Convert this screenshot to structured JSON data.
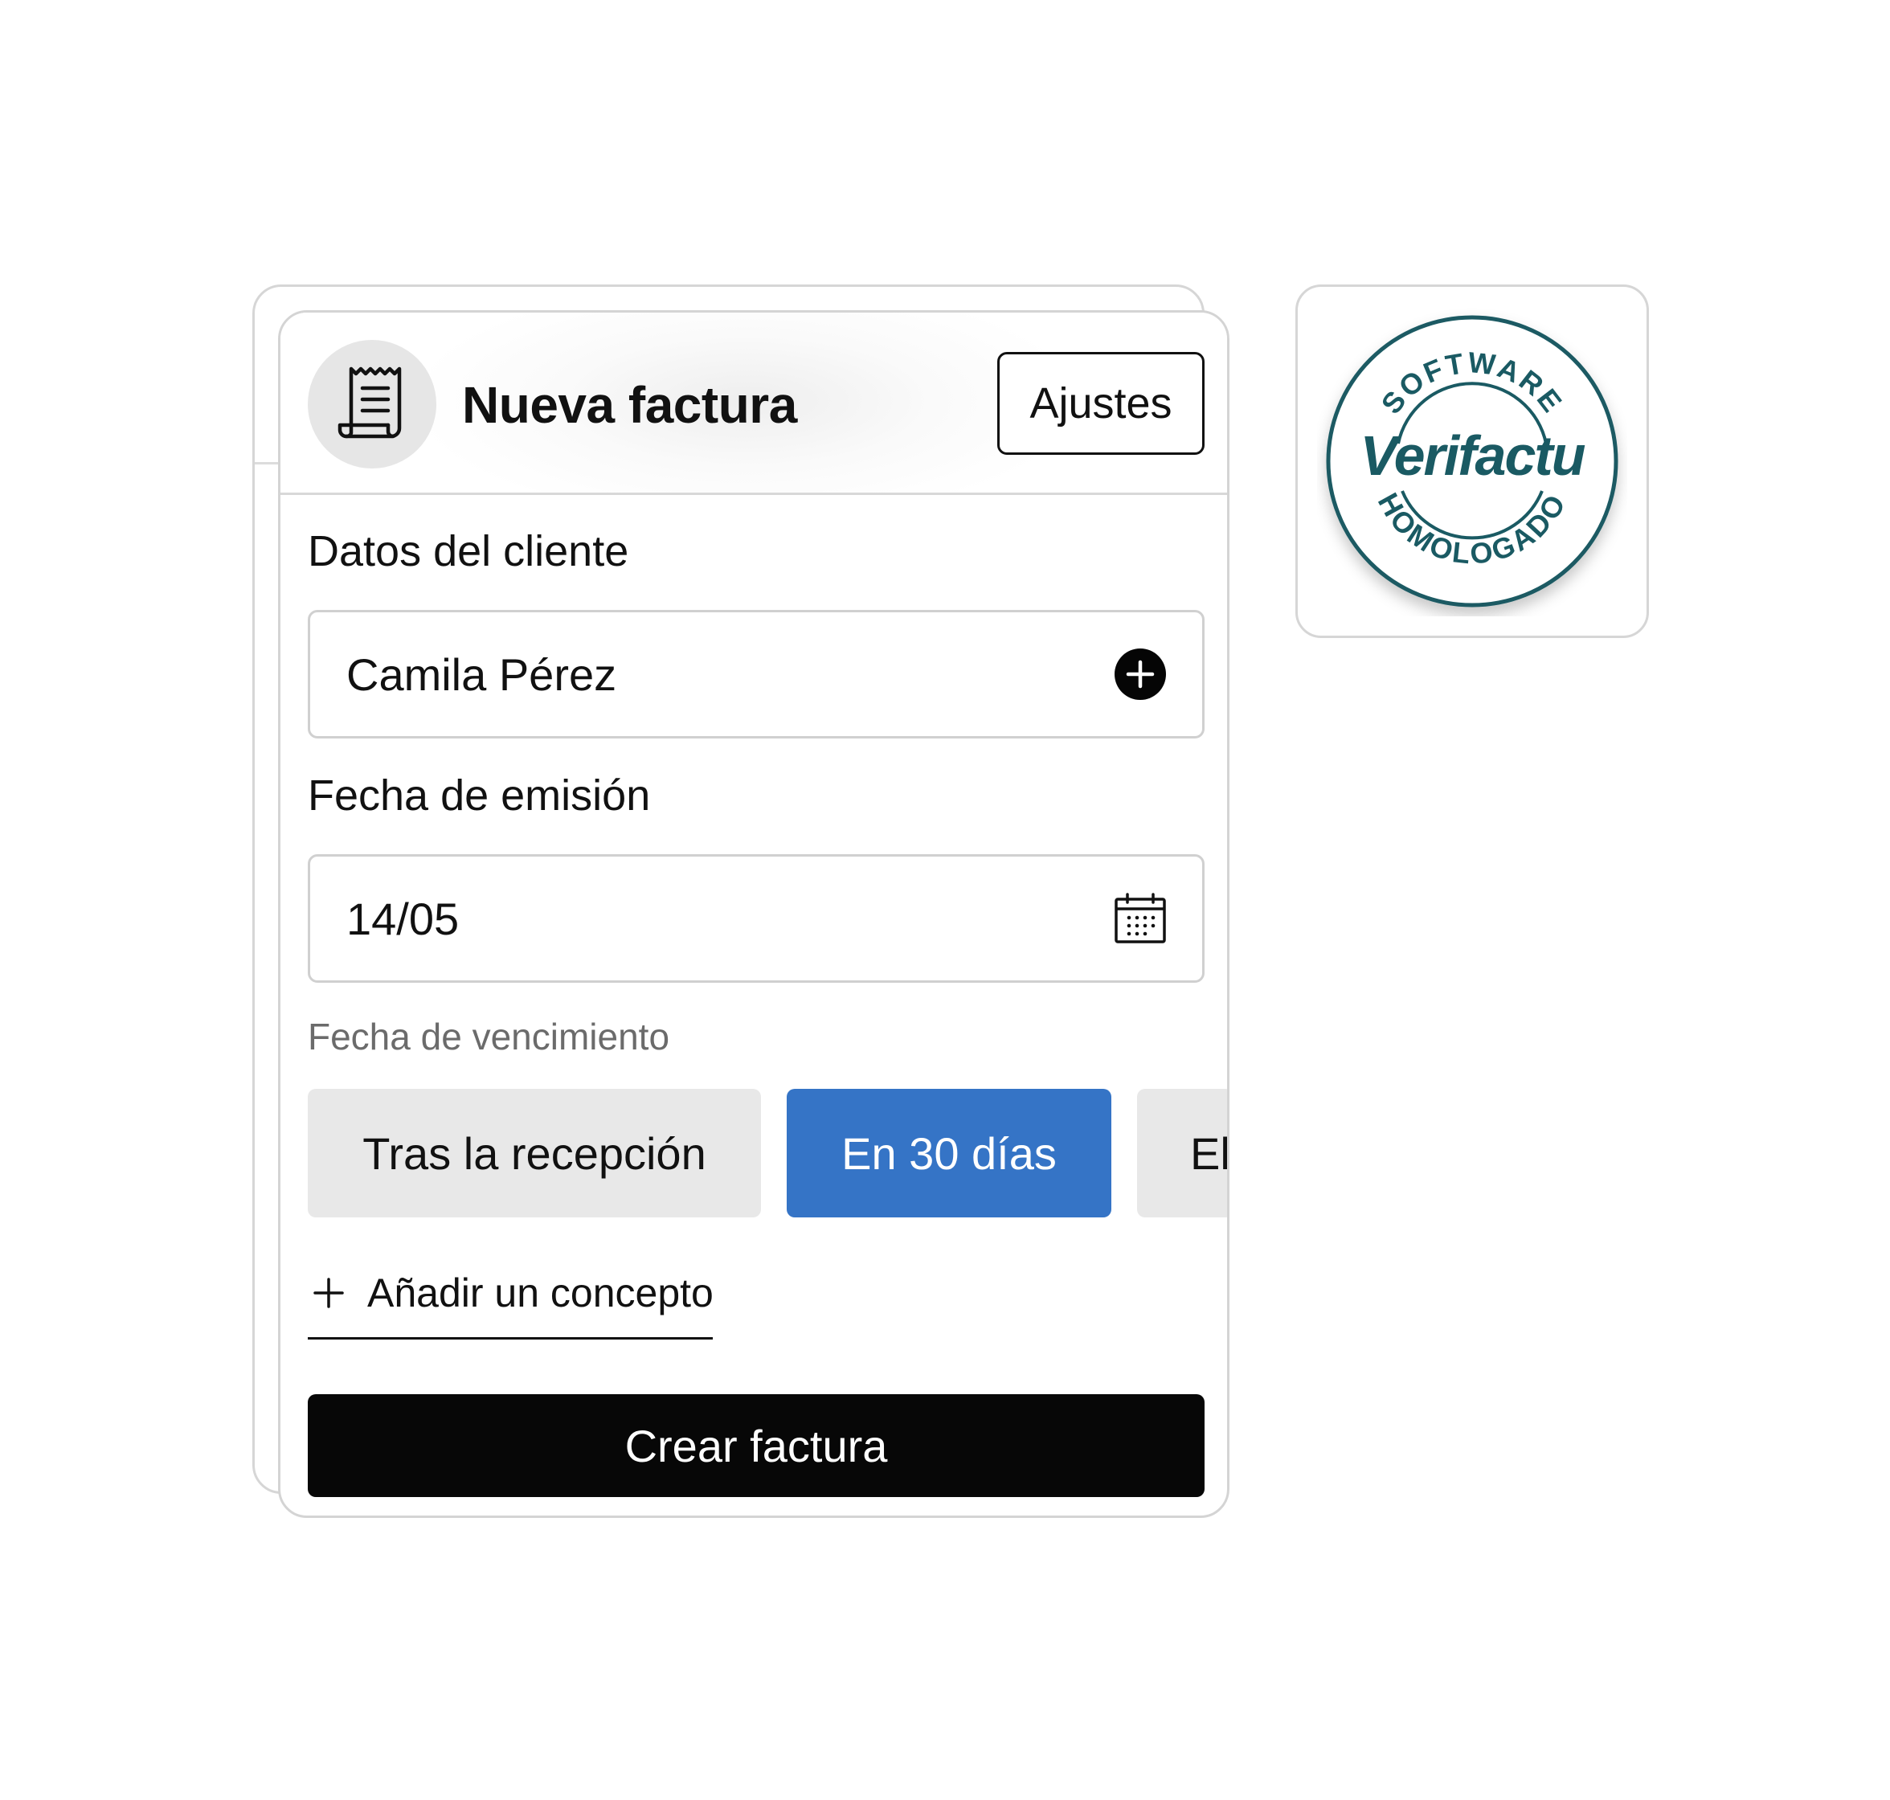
{
  "invoice_form": {
    "title": "Nueva factura",
    "settings_label": "Ajustes",
    "client": {
      "label": "Datos del cliente",
      "value": "Camila Pérez"
    },
    "issue_date": {
      "label": "Fecha de emisión",
      "value": "14/05"
    },
    "due_date": {
      "label": "Fecha de vencimiento",
      "options": [
        {
          "label": "Tras la recepción",
          "selected": false
        },
        {
          "label": "En 30 días",
          "selected": true
        },
        {
          "label": "El",
          "selected": false
        }
      ]
    },
    "add_concept_label": "Añadir un concepto",
    "create_label": "Crear factura"
  },
  "badge": {
    "top_text": "SOFTWARE",
    "main_text": "Verifactu",
    "bottom_text": "HOMOLOGADO",
    "color": "#1a5a63"
  },
  "colors": {
    "accent": "#3574c6",
    "primary_button": "#070707",
    "segment_bg": "#e8e8e8"
  },
  "icons": {
    "header": "receipt-icon",
    "client_field": "plus-circle-icon",
    "date_field": "calendar-icon",
    "add_concept": "plus-icon"
  }
}
